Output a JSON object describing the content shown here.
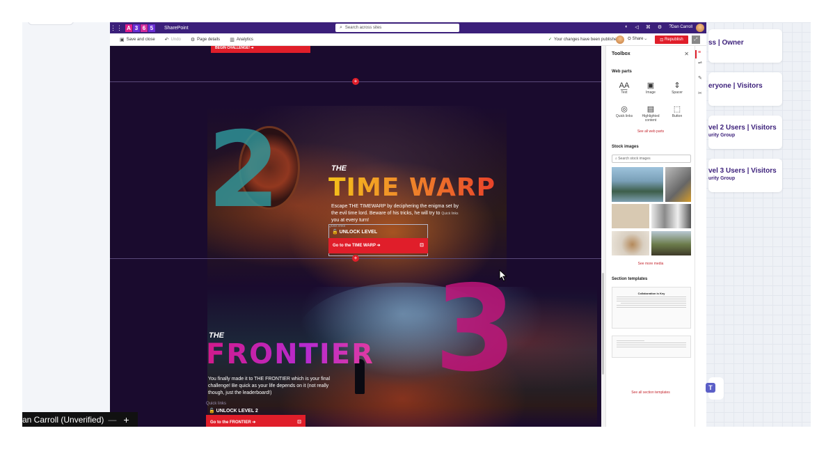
{
  "suite": {
    "brand_letters": [
      "A",
      "3",
      "6",
      "5"
    ],
    "brand_colors": [
      "#e01e8a",
      "#6b2fd6",
      "#d12a9a",
      "#6b2fd6"
    ],
    "app_name": "SharePoint",
    "search_placeholder": "Search across sites",
    "user_name": "Dan Carroll"
  },
  "cmdbar": {
    "save_close": "Save and close",
    "undo": "Undo",
    "page_details": "Page details",
    "analytics": "Analytics",
    "published_msg": "Your changes have been published",
    "share": "Share",
    "republish": "Republish"
  },
  "canvas": {
    "top_button_label": "BEGIN CHALLENGE! ➔",
    "level2": {
      "number": "2",
      "the": "THE",
      "title": "TIME WARP",
      "description": "Escape THE TIMEWARP by deciphering the enigma set by the evil time lord. Beware of his tricks, he will try to",
      "description_tail": "you at every turn!",
      "quick_links_inline": "Quick links",
      "quick_links_tag": "Quick links",
      "unlock": "🔓 UNLOCK LEVEL",
      "cta": "Go to the TIME WARP ➔"
    },
    "level3": {
      "number": "3",
      "the": "THE",
      "title": "FRONTIER",
      "description": "You finally made it to THE FRONTIER which is your final challenge! Be quick as your life depends on it (not really though, just the leaderboard!)",
      "quick_links": "Quick links",
      "unlock": "🔓 UNLOCK LEVEL 2",
      "cta": "Go to the FRONTIER ➔"
    }
  },
  "toolbox": {
    "title": "Toolbox",
    "web_parts_heading": "Web parts",
    "web_parts": [
      {
        "label": "Text",
        "glyph": "A͟A"
      },
      {
        "label": "Image",
        "glyph": "▣"
      },
      {
        "label": "Spacer",
        "glyph": "⇕"
      },
      {
        "label": "Quick links",
        "glyph": "◎"
      },
      {
        "label": "Highlighted content",
        "glyph": "▤"
      },
      {
        "label": "Button",
        "glyph": "⬚"
      }
    ],
    "see_all_web_parts": "See all web parts",
    "stock_images_heading": "Stock images",
    "stock_search_placeholder": "Search stock images",
    "see_more_media": "See more media",
    "section_templates_heading": "Section templates",
    "template_title": "Collaboration is Key",
    "see_all_section_templates": "See all section templates"
  },
  "right_cards": [
    {
      "title": "ss | Owner",
      "subtitle": ""
    },
    {
      "title": "eryone | Visitors",
      "subtitle": ""
    },
    {
      "title": "vel 2 Users | Visitors",
      "subtitle": "urity Group"
    },
    {
      "title": "vel 3 Users | Visitors",
      "subtitle": "urity Group"
    }
  ],
  "footer": {
    "name": "an Carroll (Unverified)"
  },
  "colors": {
    "accent_red": "#e01e2a",
    "suite_purple": "#3b1f7a",
    "canvas_bg": "#1a0b2e"
  }
}
